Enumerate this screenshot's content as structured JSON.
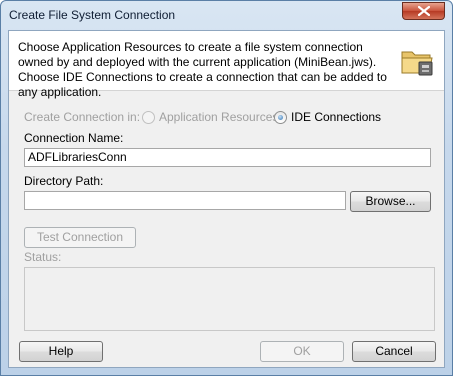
{
  "window": {
    "title": "Create File System Connection"
  },
  "header": {
    "description": "Choose Application Resources to create a file system connection owned by and deployed with the current application (MiniBean.jws). Choose IDE Connections to create a connection that can be added to any application.",
    "icon": "folder-connection-icon"
  },
  "create_in": {
    "label": "Create Connection in:",
    "options": [
      {
        "label": "Application Resources",
        "selected": false,
        "enabled": false
      },
      {
        "label": "IDE Connections",
        "selected": true,
        "enabled": true
      }
    ]
  },
  "connection_name": {
    "label": "Connection Name:",
    "value": "ADFLibrariesConn"
  },
  "directory_path": {
    "label": "Directory Path:",
    "value": ""
  },
  "buttons": {
    "browse": "Browse...",
    "test_connection": "Test Connection",
    "help": "Help",
    "ok": "OK",
    "cancel": "Cancel"
  },
  "status": {
    "label": "Status:",
    "value": ""
  },
  "colors": {
    "dialog_bg": "#f0f0f0",
    "title_bar": "#c6d8ec",
    "close_button": "#c9523b",
    "disabled_text": "#a0a0a0"
  }
}
